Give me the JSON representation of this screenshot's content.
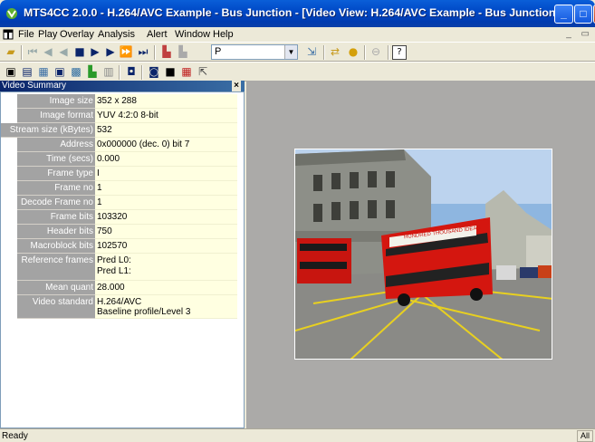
{
  "window": {
    "title": "MTS4CC 2.0.0 - H.264/AVC Example - Bus Junction - [Video View: H.264/AVC Example - Bus Junction]",
    "minimize_glyph": "_",
    "maximize_glyph": "□",
    "close_glyph": "X"
  },
  "menu": {
    "items": [
      "File",
      "Play",
      "Overlay",
      "Analysis",
      "Alert",
      "Window",
      "Help"
    ],
    "mdi_controls": "_ ▭"
  },
  "toolbar": {
    "frame_type_value": "P",
    "combo_arrow": "▼"
  },
  "summary_panel": {
    "title": "Video Summary",
    "close_glyph": "×",
    "rows": [
      {
        "key": "Image size",
        "value": "352 x 288"
      },
      {
        "key": "Image format",
        "value": "YUV 4:2:0 8-bit"
      },
      {
        "key": "Stream size (kBytes)",
        "value": "532"
      },
      {
        "key": "Address",
        "value": "0x000000 (dec. 0) bit 7"
      },
      {
        "key": "Time (secs)",
        "value": "0.000"
      },
      {
        "key": "Frame type",
        "value": "I"
      },
      {
        "key": "Frame no",
        "value": "1"
      },
      {
        "key": "Decode Frame no",
        "value": "1"
      },
      {
        "key": "Frame bits",
        "value": "103320"
      },
      {
        "key": "Header bits",
        "value": "750"
      },
      {
        "key": "Macroblock bits",
        "value": "102570"
      },
      {
        "key": "Reference frames",
        "value": "Pred L0:",
        "value2": "Pred L1:"
      },
      {
        "key": "Mean quant",
        "value": "28.000"
      },
      {
        "key": "Video standard",
        "value": "H.264/AVC",
        "value2": "Baseline profile/Level 3"
      }
    ]
  },
  "video_view": {
    "bus_banner": "HUNDRED THOUSAND IDEAS"
  },
  "status": {
    "text": "Ready",
    "indicator": "All"
  }
}
